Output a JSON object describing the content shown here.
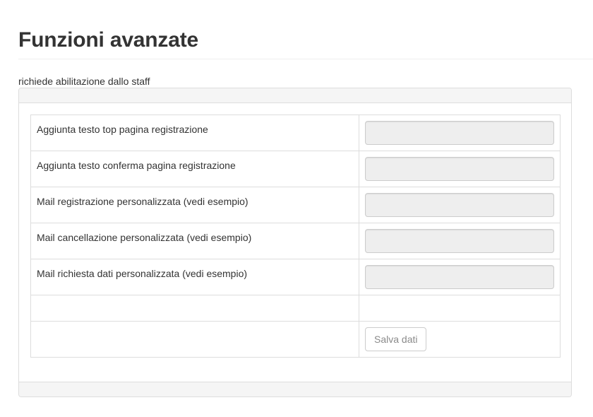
{
  "page": {
    "title": "Funzioni avanzate",
    "subtitle": "richiede abilitazione dallo staff"
  },
  "form": {
    "rows": [
      {
        "label": "Aggiunta testo top pagina registrazione",
        "value": ""
      },
      {
        "label": "Aggiunta testo conferma pagina registrazione",
        "value": ""
      },
      {
        "label": "Mail registrazione personalizzata (vedi esempio)",
        "value": ""
      },
      {
        "label": "Mail cancellazione personalizzata (vedi esempio)",
        "value": ""
      },
      {
        "label": "Mail richiesta dati personalizzata (vedi esempio)",
        "value": ""
      }
    ],
    "save_label": "Salva dati"
  },
  "colors": {
    "panel_border": "#dddddd",
    "panel_header_bg": "#f5f5f5",
    "input_bg": "#eeeeee",
    "text": "#333333"
  }
}
